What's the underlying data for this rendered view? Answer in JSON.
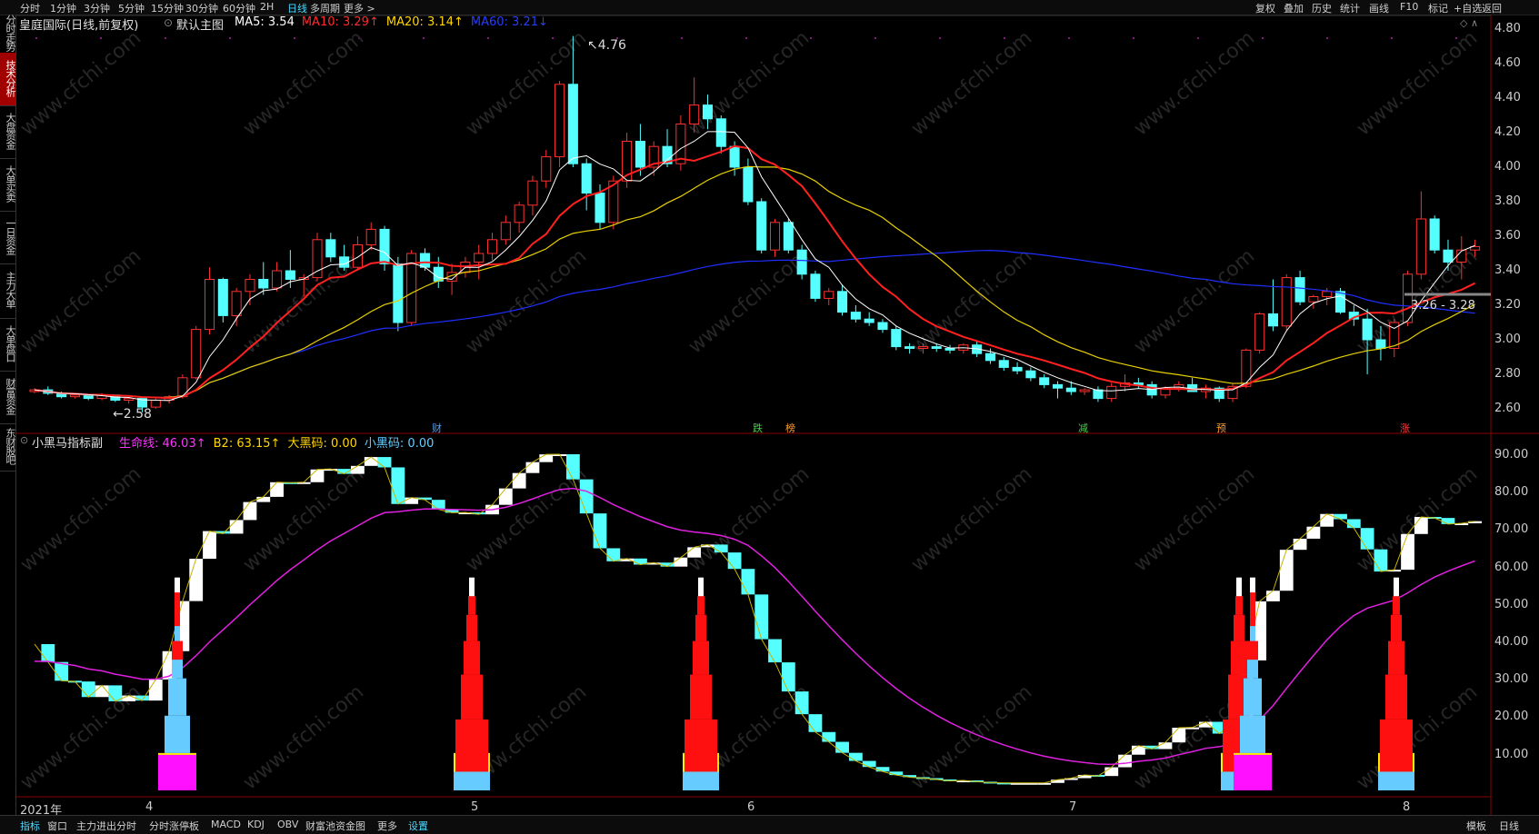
{
  "toolbar": {
    "periods": [
      "分时",
      "1分钟",
      "3分钟",
      "5分钟",
      "15分钟",
      "30分钟",
      "60分钟",
      "2H",
      "日线",
      "多周期",
      "更多 >"
    ],
    "active_period": "日线",
    "right_tools": [
      "复权",
      "叠加",
      "历史",
      "统计",
      "画线",
      "F10",
      "标记",
      "+自选",
      "返回"
    ]
  },
  "sidebar": {
    "tabs": [
      "分时走势",
      "技术分析",
      "大盘资金",
      "大单买卖",
      "一日资金",
      "主力大单",
      "大单盘口",
      "财富资金",
      "东财股吧"
    ],
    "active": "技术分析"
  },
  "main_panel": {
    "title": "皇庭国际(日线,前复权)",
    "template": "默认主图",
    "ma": [
      {
        "name": "MA5",
        "value": "3.54",
        "color": "#ffffff"
      },
      {
        "name": "MA10",
        "value": "3.29↑",
        "color": "#ff2a2a"
      },
      {
        "name": "MA20",
        "value": "3.14↑",
        "color": "#ffd600"
      },
      {
        "name": "MA60",
        "value": "3.21↓",
        "color": "#2a3cff"
      }
    ],
    "high_label": "4.76",
    "low_label": "2.58",
    "crosshair_label": "3.26 - 3.28",
    "markers": [
      {
        "text": "财",
        "color": "#4aa0ff"
      },
      {
        "text": "跌",
        "color": "#3fd23f"
      },
      {
        "text": "榜",
        "color": "#ff9a2a"
      },
      {
        "text": "减",
        "color": "#3fd23f"
      },
      {
        "text": "预",
        "color": "#ff9a2a"
      },
      {
        "text": "涨",
        "color": "#ff3a3a"
      }
    ],
    "yaxis": [
      "4.80",
      "4.60",
      "4.40",
      "4.20",
      "4.00",
      "3.80",
      "3.60",
      "3.40",
      "3.20",
      "3.00",
      "2.80",
      "2.60"
    ],
    "candles": [
      [
        2.7,
        2.72,
        2.69,
        2.71
      ],
      [
        2.71,
        2.73,
        2.68,
        2.69
      ],
      [
        2.69,
        2.7,
        2.66,
        2.67
      ],
      [
        2.67,
        2.69,
        2.66,
        2.68
      ],
      [
        2.68,
        2.68,
        2.65,
        2.66
      ],
      [
        2.66,
        2.69,
        2.65,
        2.68
      ],
      [
        2.68,
        2.68,
        2.64,
        2.65
      ],
      [
        2.65,
        2.67,
        2.63,
        2.66
      ],
      [
        2.66,
        2.66,
        2.58,
        2.61
      ],
      [
        2.61,
        2.66,
        2.6,
        2.65
      ],
      [
        2.65,
        2.68,
        2.63,
        2.67
      ],
      [
        2.67,
        2.8,
        2.66,
        2.78
      ],
      [
        2.78,
        3.08,
        2.77,
        3.06
      ],
      [
        3.06,
        3.42,
        3.03,
        3.35
      ],
      [
        3.35,
        3.36,
        3.1,
        3.14
      ],
      [
        3.14,
        3.3,
        3.08,
        3.28
      ],
      [
        3.28,
        3.38,
        3.2,
        3.35
      ],
      [
        3.35,
        3.45,
        3.26,
        3.3
      ],
      [
        3.3,
        3.45,
        3.28,
        3.4
      ],
      [
        3.4,
        3.52,
        3.3,
        3.35
      ],
      [
        3.35,
        3.38,
        3.25,
        3.36
      ],
      [
        3.36,
        3.62,
        3.34,
        3.58
      ],
      [
        3.58,
        3.62,
        3.45,
        3.48
      ],
      [
        3.48,
        3.55,
        3.4,
        3.42
      ],
      [
        3.42,
        3.6,
        3.4,
        3.55
      ],
      [
        3.55,
        3.68,
        3.52,
        3.64
      ],
      [
        3.64,
        3.66,
        3.4,
        3.44
      ],
      [
        3.44,
        3.48,
        3.05,
        3.1
      ],
      [
        3.1,
        3.52,
        3.08,
        3.5
      ],
      [
        3.5,
        3.53,
        3.4,
        3.42
      ],
      [
        3.42,
        3.48,
        3.3,
        3.34
      ],
      [
        3.34,
        3.44,
        3.26,
        3.39
      ],
      [
        3.39,
        3.48,
        3.36,
        3.45
      ],
      [
        3.45,
        3.55,
        3.35,
        3.5
      ],
      [
        3.5,
        3.62,
        3.46,
        3.58
      ],
      [
        3.58,
        3.72,
        3.55,
        3.68
      ],
      [
        3.68,
        3.8,
        3.62,
        3.78
      ],
      [
        3.78,
        3.95,
        3.72,
        3.92
      ],
      [
        3.92,
        4.1,
        3.88,
        4.06
      ],
      [
        4.06,
        4.5,
        4.0,
        4.48
      ],
      [
        4.48,
        4.76,
        4.0,
        4.02
      ],
      [
        4.02,
        4.05,
        3.75,
        3.85
      ],
      [
        3.85,
        3.9,
        3.64,
        3.68
      ],
      [
        3.68,
        3.95,
        3.64,
        3.92
      ],
      [
        3.92,
        4.2,
        3.88,
        4.15
      ],
      [
        4.15,
        4.25,
        3.95,
        4.0
      ],
      [
        4.0,
        4.15,
        3.95,
        4.12
      ],
      [
        4.12,
        4.22,
        4.0,
        4.02
      ],
      [
        4.02,
        4.3,
        3.98,
        4.25
      ],
      [
        4.25,
        4.52,
        4.2,
        4.36
      ],
      [
        4.36,
        4.42,
        4.22,
        4.28
      ],
      [
        4.28,
        4.3,
        4.08,
        4.12
      ],
      [
        4.12,
        4.15,
        3.95,
        4.0
      ],
      [
        4.0,
        4.05,
        3.78,
        3.8
      ],
      [
        3.8,
        3.82,
        3.5,
        3.52
      ],
      [
        3.52,
        3.7,
        3.48,
        3.68
      ],
      [
        3.68,
        3.7,
        3.5,
        3.52
      ],
      [
        3.52,
        3.55,
        3.35,
        3.38
      ],
      [
        3.38,
        3.4,
        3.22,
        3.24
      ],
      [
        3.24,
        3.3,
        3.2,
        3.28
      ],
      [
        3.28,
        3.32,
        3.14,
        3.16
      ],
      [
        3.16,
        3.2,
        3.1,
        3.12
      ],
      [
        3.12,
        3.16,
        3.08,
        3.1
      ],
      [
        3.1,
        3.12,
        3.04,
        3.06
      ],
      [
        3.06,
        3.08,
        2.94,
        2.96
      ],
      [
        2.96,
        2.98,
        2.92,
        2.95
      ],
      [
        2.95,
        2.98,
        2.92,
        2.96
      ],
      [
        2.96,
        2.98,
        2.93,
        2.95
      ],
      [
        2.95,
        2.97,
        2.92,
        2.94
      ],
      [
        2.94,
        2.98,
        2.92,
        2.97
      ],
      [
        2.97,
        2.99,
        2.9,
        2.92
      ],
      [
        2.92,
        2.95,
        2.86,
        2.88
      ],
      [
        2.88,
        2.9,
        2.82,
        2.84
      ],
      [
        2.84,
        2.87,
        2.8,
        2.82
      ],
      [
        2.82,
        2.84,
        2.76,
        2.78
      ],
      [
        2.78,
        2.8,
        2.72,
        2.74
      ],
      [
        2.74,
        2.76,
        2.66,
        2.72
      ],
      [
        2.72,
        2.76,
        2.68,
        2.7
      ],
      [
        2.7,
        2.72,
        2.68,
        2.71
      ],
      [
        2.71,
        2.73,
        2.64,
        2.66
      ],
      [
        2.66,
        2.75,
        2.64,
        2.73
      ],
      [
        2.73,
        2.8,
        2.7,
        2.75
      ],
      [
        2.75,
        2.78,
        2.72,
        2.74
      ],
      [
        2.74,
        2.76,
        2.66,
        2.68
      ],
      [
        2.68,
        2.73,
        2.66,
        2.72
      ],
      [
        2.72,
        2.76,
        2.7,
        2.74
      ],
      [
        2.74,
        2.78,
        2.7,
        2.7
      ],
      [
        2.7,
        2.74,
        2.66,
        2.72
      ],
      [
        2.72,
        2.73,
        2.64,
        2.66
      ],
      [
        2.66,
        2.75,
        2.64,
        2.73
      ],
      [
        2.73,
        2.95,
        2.72,
        2.94
      ],
      [
        2.94,
        3.16,
        2.92,
        3.15
      ],
      [
        3.15,
        3.35,
        3.05,
        3.08
      ],
      [
        3.08,
        3.38,
        3.05,
        3.36
      ],
      [
        3.36,
        3.4,
        3.2,
        3.22
      ],
      [
        3.22,
        3.26,
        3.18,
        3.25
      ],
      [
        3.25,
        3.3,
        3.2,
        3.28
      ],
      [
        3.28,
        3.3,
        3.15,
        3.16
      ],
      [
        3.16,
        3.2,
        3.08,
        3.12
      ],
      [
        3.12,
        3.18,
        2.8,
        3.0
      ],
      [
        3.0,
        3.08,
        2.88,
        2.95
      ],
      [
        2.95,
        3.12,
        2.9,
        3.1
      ],
      [
        3.1,
        3.4,
        3.08,
        3.38
      ],
      [
        3.38,
        3.86,
        3.35,
        3.7
      ],
      [
        3.7,
        3.72,
        3.5,
        3.52
      ],
      [
        3.52,
        3.58,
        3.4,
        3.45
      ],
      [
        3.45,
        3.6,
        3.35,
        3.52
      ],
      [
        3.52,
        3.58,
        3.48,
        3.54
      ]
    ]
  },
  "sub_panel": {
    "title": "小黑马指标副",
    "lines": [
      {
        "name": "生命线",
        "value": "46.03↑",
        "color": "#ff33ff"
      },
      {
        "name": "B2",
        "value": "63.15↑",
        "color": "#ffd600"
      },
      {
        "name": "大黑码",
        "value": "0.00",
        "color": "#ffd600"
      },
      {
        "name": "小黑码",
        "value": "0.00",
        "color": "#66ccff"
      }
    ],
    "yaxis": [
      "90.00",
      "80.00",
      "70.00",
      "60.00",
      "50.00",
      "40.00",
      "30.00",
      "20.00",
      "10.00"
    ]
  },
  "xaxis": {
    "year_label": "2021年",
    "months": [
      "4",
      "5",
      "6",
      "7",
      "8"
    ]
  },
  "bottom_tabs": {
    "items": [
      "指标",
      "窗口",
      "主力进出分时",
      "分时涨停板",
      "MACD",
      "KDJ",
      "OBV",
      "财富池资金图",
      "更多",
      "设置"
    ],
    "active": "指标",
    "right": [
      "模板",
      "日线"
    ]
  },
  "watermark": "www.cfchi.com",
  "colors": {
    "up": "#ff3030",
    "down": "#55ffff",
    "ma5": "#ffffff",
    "ma10": "#ff2020",
    "ma20": "#e8d000",
    "ma60": "#1f2fff",
    "life": "#e020e0"
  }
}
